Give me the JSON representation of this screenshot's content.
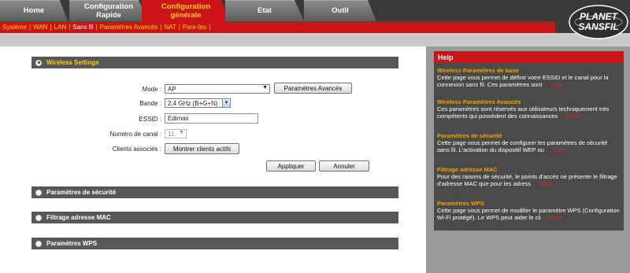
{
  "tabs": [
    {
      "label": "Home",
      "sub": ""
    },
    {
      "label": "Configuration",
      "sub": "Rapide"
    },
    {
      "label": "Configuration",
      "sub": "générale"
    },
    {
      "label": "Etat",
      "sub": ""
    },
    {
      "label": "Outil",
      "sub": ""
    }
  ],
  "subnav": [
    "Système",
    "WAN",
    "LAN",
    "Sans fil",
    "Paramètres Avancés",
    "NAT",
    "Pare-feu"
  ],
  "logo": {
    "line1": "PLANET",
    "line2": "SANSFIL"
  },
  "sections": {
    "wireless": "Wireless Settings",
    "security": "Paramètres de sécurité",
    "mac": "Filtrage adresse MAC",
    "wps": "Paramètres WPS"
  },
  "form": {
    "mode_label": "Mode :",
    "mode_value": "AP",
    "adv_button": "Paramètres Avancés",
    "band_label": "Bande :",
    "band_value": "2.4 GHz (B+G+N)",
    "essid_label": "ESSID :",
    "essid_value": "Edimax",
    "channel_label": "Numéro de canal :",
    "channel_value": "11",
    "clients_label": "Clients associés :",
    "clients_button": "Montrer clients actifs",
    "apply": "Appliquer",
    "cancel": "Annuler"
  },
  "help": {
    "title": "Help",
    "items": [
      {
        "heading": "Wireless Paramètres de base",
        "text": "Cette page vous permet de définir votre ESSID et le canal pour la connexion sans fil. Ces paramètres sont ",
        "more": "....more"
      },
      {
        "heading": "Wireless Paramètres Avancés",
        "text": "Ces paramètres sont réservés aux utilisateurs techniquement très compétents qui possèdent des connaissances ",
        "more": "....more"
      },
      {
        "heading": "Paramètres de sécurité",
        "text": "Cette page vous permet de configurer les paramètres de sécurité sans fil. L'activation du dispositif WEP ou ",
        "more": "....more"
      },
      {
        "heading": "Filtrage adresse MAC",
        "text": "Pour des raisons de sécurité, le points d'accès ne présente le filtrage d'adresse MAC que pour les adress ",
        "more": "....more"
      },
      {
        "heading": "Paramètres WPS",
        "text": "Cette page vous permet de modifier le paramètre WPS (Configuration Wi-Fi protégé). Le WPS peut aider le cli ",
        "more": "....more"
      }
    ]
  },
  "colors": {
    "accent_red": "#cc1418",
    "highlight_yellow": "#ffd200",
    "help_heading": "#f5a300"
  }
}
